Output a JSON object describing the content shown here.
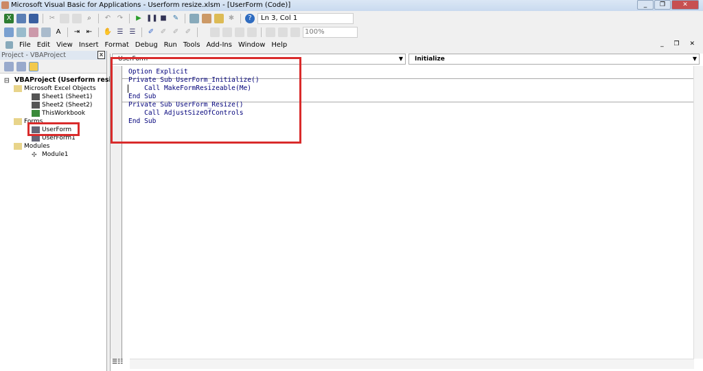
{
  "window": {
    "title": "Microsoft Visual Basic for Applications - Userform resize.xlsm - [UserForm (Code)]"
  },
  "toolbar": {
    "cursor_position": "Ln 3, Col 1",
    "zoom": "100%"
  },
  "menu": [
    "File",
    "Edit",
    "View",
    "Insert",
    "Format",
    "Debug",
    "Run",
    "Tools",
    "Add-Ins",
    "Window",
    "Help"
  ],
  "project": {
    "title": "Project - VBAProject",
    "root": "VBAProject (Userform resize.xlsm)",
    "folders": {
      "excel": "Microsoft Excel Objects",
      "forms": "Forms",
      "modules": "Modules"
    },
    "items": {
      "sheet1": "Sheet1 (Sheet1)",
      "sheet2": "Sheet2 (Sheet2)",
      "workbook": "ThisWorkbook",
      "userform": "UserForm",
      "userform1": "UserForm1",
      "module1": "Module1"
    }
  },
  "editor": {
    "object": "UserForm",
    "procedure": "Initialize",
    "lines": [
      "Option Explicit",
      "Private Sub UserForm_Initialize()",
      "    Call MakeFormResizeable(Me)",
      "End Sub",
      "Private Sub UserForm_Resize()",
      "    Call AdjustSizeOfControls",
      "End Sub"
    ]
  },
  "colors": {
    "highlight": "#d92b2b",
    "code": "#00007a"
  }
}
